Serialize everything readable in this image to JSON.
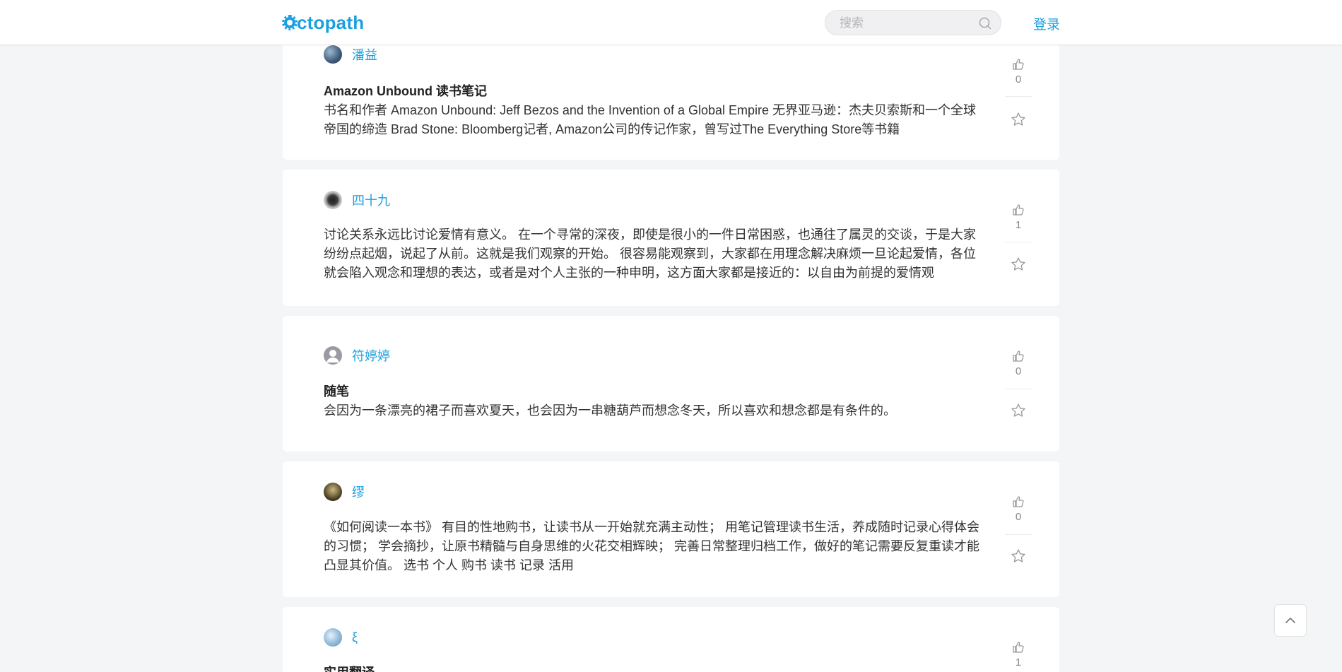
{
  "header": {
    "logo_text": "ctopath",
    "search_placeholder": "搜索",
    "login_label": "登录"
  },
  "colors": {
    "accent": "#1a9fe0",
    "background": "#f4f5f7"
  },
  "posts": [
    {
      "author": "潘益",
      "avatar": "avatar-landscape",
      "title": "Amazon Unbound 读书笔记",
      "excerpt": "书名和作者 Amazon Unbound: Jeff Bezos and the Invention of a Global Empire 无界亚马逊：杰夫贝索斯和一个全球帝国的缔造 Brad Stone: Bloomberg记者, Amazon公司的传记作家，曾写过The Everything Store等书籍",
      "likes": "0"
    },
    {
      "author": "四十九",
      "avatar": "avatar-bird",
      "title": "",
      "excerpt": "讨论关系永远比讨论爱情有意义。 在一个寻常的深夜，即使是很小的一件日常困惑，也通往了属灵的交谈，于是大家纷纷点起烟，说起了从前。这就是我们观察的开始。 很容易能观察到，大家都在用理念解决麻烦一旦论起爱情，各位就会陷入观念和理想的表达，或者是对个人主张的一种申明，这方面大家都是接近的：以自由为前提的爱情观",
      "likes": "1"
    },
    {
      "author": "符婷婷",
      "avatar": "avatar-default",
      "title": "随笔",
      "excerpt": "会因为一条漂亮的裙子而喜欢夏天，也会因为一串糖葫芦而想念冬天，所以喜欢和想念都是有条件的。",
      "likes": "0"
    },
    {
      "author": "缪",
      "avatar": "avatar-portrait",
      "title": "",
      "excerpt": "《如何阅读一本书》 有目的性地购书，让读书从一开始就充满主动性； 用笔记管理读书生活，养成随时记录心得体会的习惯； 学会摘抄，让原书精髓与自身思维的火花交相辉映； 完善日常整理归档工作，做好的笔记需要反复重读才能凸显其价值。 选书 个人 购书 读书 记录 活用",
      "likes": "0"
    },
    {
      "author": "ξ",
      "avatar": "avatar-sky",
      "title": "实用翻译",
      "excerpt": "",
      "likes": "1"
    }
  ]
}
